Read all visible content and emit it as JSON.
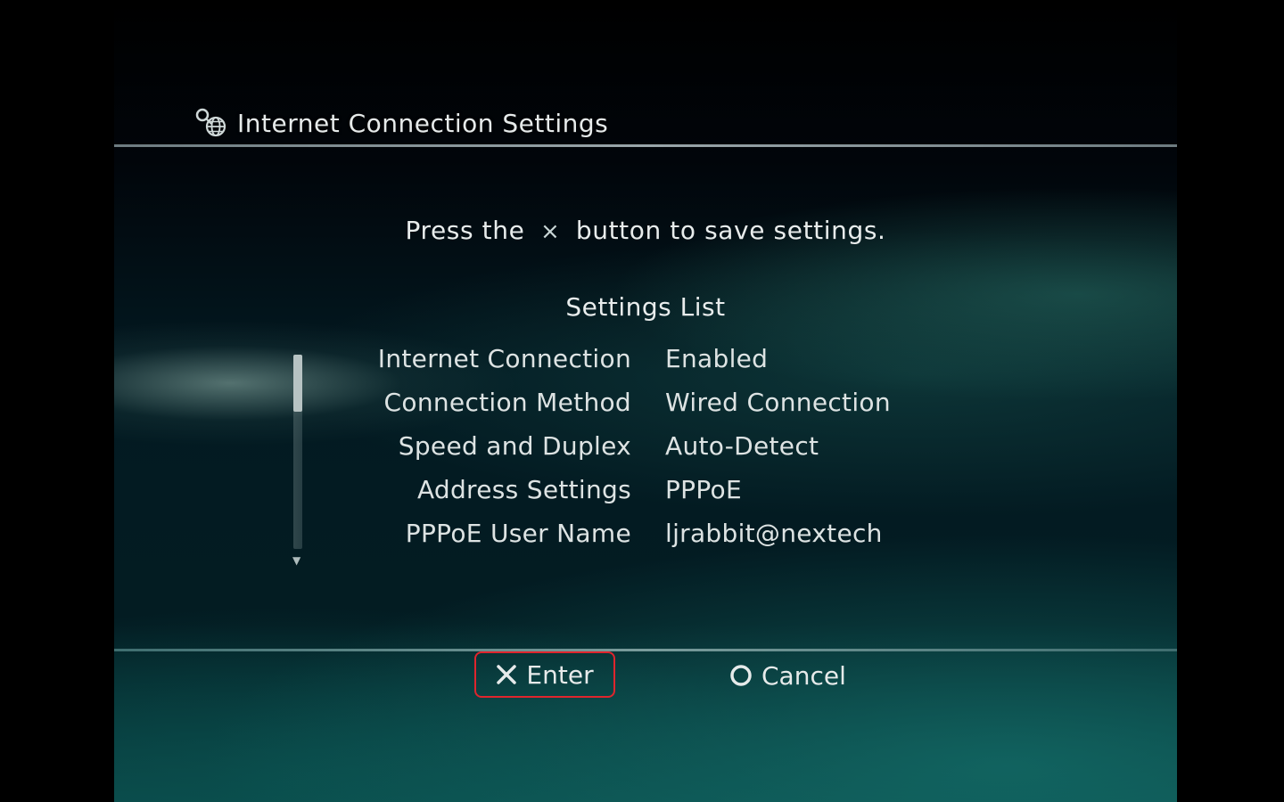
{
  "header": {
    "title": "Internet Connection Settings",
    "icon": "network-globe-icon"
  },
  "prompt": {
    "before": "Press the",
    "glyph": "×",
    "after": "button to save settings."
  },
  "settings_list": {
    "title": "Settings List",
    "rows": [
      {
        "label": "Internet Connection",
        "value": "Enabled"
      },
      {
        "label": "Connection Method",
        "value": "Wired Connection"
      },
      {
        "label": "Speed and Duplex",
        "value": "Auto-Detect"
      },
      {
        "label": "Address Settings",
        "value": "PPPoE"
      },
      {
        "label": "PPPoE User Name",
        "value": "ljrabbit@nextech"
      }
    ]
  },
  "footer": {
    "enter_label": "Enter",
    "cancel_label": "Cancel",
    "enter_icon": "cross-button-icon",
    "cancel_icon": "circle-button-icon",
    "highlight_color": "#e0252d"
  }
}
